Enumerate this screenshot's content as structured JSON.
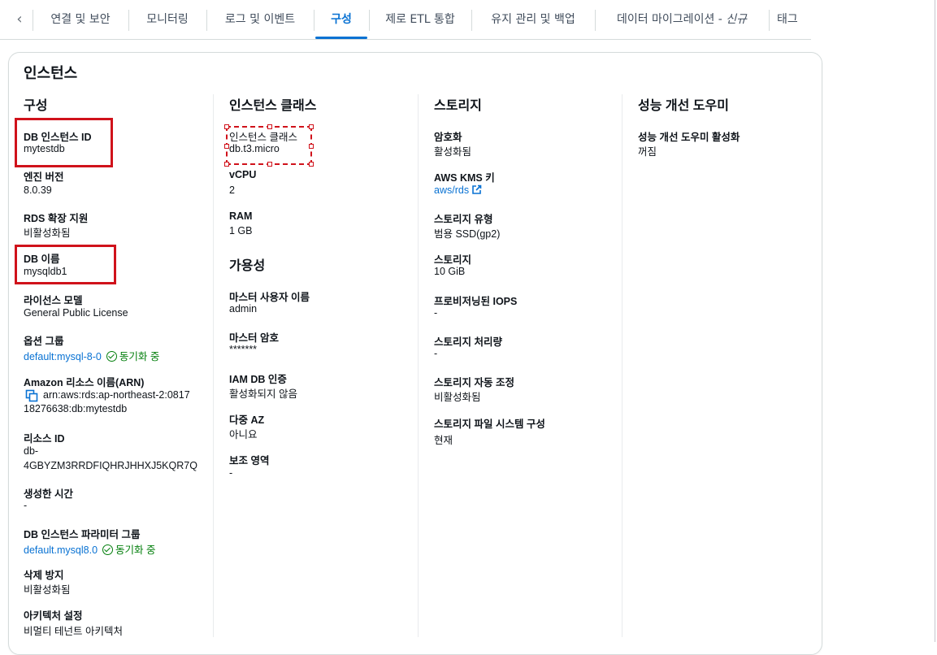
{
  "tabs": [
    {
      "label": "연결 및 보안"
    },
    {
      "label": "모니터링"
    },
    {
      "label": "로그 및 이벤트"
    },
    {
      "label": "구성",
      "active": true
    },
    {
      "label": "제로 ETL 통합"
    },
    {
      "label": "유지 관리 및 백업"
    },
    {
      "label": "데이터 마이그레이션 - ",
      "suffix": "신규"
    },
    {
      "label": "태그"
    }
  ],
  "panel": {
    "title": "인스턴스"
  },
  "configuration": {
    "heading": "구성",
    "instance_id": {
      "label": "DB 인스턴스 ID",
      "value": "mytestdb"
    },
    "engine_version": {
      "label": "엔진 버전",
      "value": "8.0.39"
    },
    "rds_extended_support": {
      "label": "RDS 확장 지원",
      "value": "비활성화됨"
    },
    "db_name": {
      "label": "DB 이름",
      "value": "mysqldb1"
    },
    "license_model": {
      "label": "라이선스 모델",
      "value": "General Public License"
    },
    "option_group": {
      "label": "옵션 그룹",
      "value": "default:mysql-8-0",
      "status": "동기화 중"
    },
    "arn": {
      "label": "Amazon 리소스 이름(ARN)",
      "value_line1": "arn:aws:rds:ap-northeast-2:0817",
      "value_line2": "18276638:db:mytestdb"
    },
    "resource_id": {
      "label": "리소스 ID",
      "value_line1": "db-",
      "value_line2": "4GBYZM3RRDFIQHRJHHXJ5KQR7Q"
    },
    "created_time": {
      "label": "생성한 시간",
      "value": "-"
    },
    "param_group": {
      "label": "DB 인스턴스 파라미터 그룹",
      "value": "default.mysql8.0",
      "status": "동기화 중"
    },
    "deletion_protection": {
      "label": "삭제 방지",
      "value": "비활성화됨"
    },
    "architecture": {
      "label": "아키텍처 설정",
      "value": "비멀티 테넌트 아키텍처"
    }
  },
  "instance_class": {
    "heading": "인스턴스 클래스",
    "class": {
      "label": "인스턴스 클래스",
      "value": "db.t3.micro"
    },
    "vcpu": {
      "label": "vCPU",
      "value": "2"
    },
    "ram": {
      "label": "RAM",
      "value": "1 GB"
    }
  },
  "availability": {
    "heading": "가용성",
    "master_user": {
      "label": "마스터 사용자 이름",
      "value": "admin"
    },
    "master_password": {
      "label": "마스터 암호",
      "value": "*******"
    },
    "iam_auth": {
      "label": "IAM DB 인증",
      "value": "활성화되지 않음"
    },
    "multi_az": {
      "label": "다중 AZ",
      "value": "아니요"
    },
    "secondary_zone": {
      "label": "보조 영역",
      "value": "-"
    }
  },
  "storage": {
    "heading": "스토리지",
    "encryption": {
      "label": "암호화",
      "value": "활성화됨"
    },
    "kms_key": {
      "label": "AWS KMS 키",
      "value": "aws/rds"
    },
    "storage_type": {
      "label": "스토리지 유형",
      "value": "범용 SSD(gp2)"
    },
    "storage_size": {
      "label": "스토리지",
      "value": "10 GiB"
    },
    "provisioned_iops": {
      "label": "프로비저닝된 IOPS",
      "value": "-"
    },
    "throughput": {
      "label": "스토리지 처리량",
      "value": "-"
    },
    "autoscaling": {
      "label": "스토리지 자동 조정",
      "value": "비활성화됨"
    },
    "file_system": {
      "label": "스토리지 파일 시스템 구성",
      "value": "현재"
    }
  },
  "performance_insights": {
    "heading": "성능 개선 도우미",
    "enabled": {
      "label": "성능 개선 도우미 활성화",
      "value": "꺼짐"
    }
  },
  "colors": {
    "accent": "#0972d3",
    "success": "#037f0c",
    "highlight": "#d0121b"
  }
}
